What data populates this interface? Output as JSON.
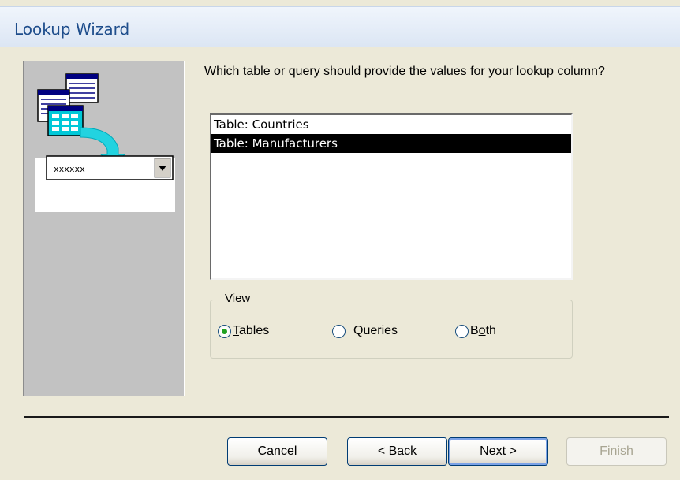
{
  "window": {
    "title": "Lookup Wizard"
  },
  "prompt": "Which table or query should provide the values for your lookup column?",
  "list": {
    "items": [
      {
        "label": "Table: Countries",
        "selected": false
      },
      {
        "label": "Table: Manufacturers",
        "selected": true
      }
    ]
  },
  "view": {
    "label": "View",
    "options": [
      {
        "pre": "",
        "key": "T",
        "post": "ables",
        "checked": true
      },
      {
        "pre": "",
        "key": "",
        "post": "Queries",
        "checked": false
      },
      {
        "pre": "B",
        "key": "o",
        "post": "th",
        "checked": false
      }
    ]
  },
  "buttons": {
    "cancel": "Cancel",
    "back": {
      "pre": "< ",
      "key": "B",
      "post": "ack"
    },
    "next": {
      "pre": "",
      "key": "N",
      "post": "ext >"
    },
    "finish": {
      "pre": "",
      "key": "F",
      "post": "inish"
    }
  },
  "colors": {
    "title_text": "#1f4e8c",
    "selection": "#000000",
    "radio_dot": "#21a121"
  },
  "icons": [
    "tables-illustration-icon",
    "arrow-down-icon",
    "combo-dropdown-icon"
  ]
}
